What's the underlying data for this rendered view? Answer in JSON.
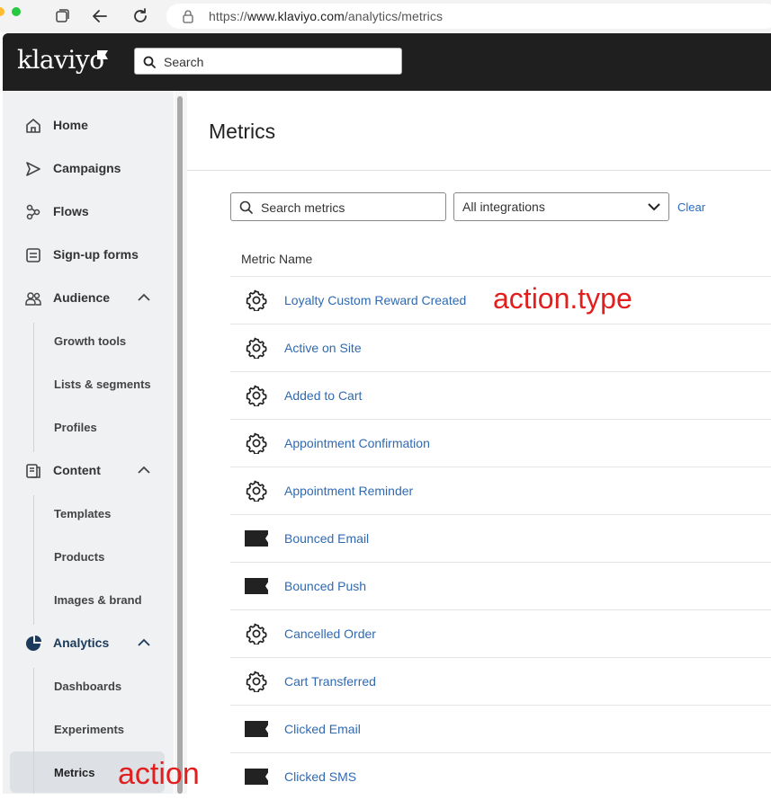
{
  "browser": {
    "url_prefix": "https://",
    "url_domain": "www.klaviyo.com",
    "url_path": "/analytics/metrics"
  },
  "header": {
    "logo": "klaviyo",
    "search_placeholder": "Search"
  },
  "sidebar": {
    "items": [
      {
        "label": "Home",
        "icon": "home-icon"
      },
      {
        "label": "Campaigns",
        "icon": "send-icon"
      },
      {
        "label": "Flows",
        "icon": "flows-icon"
      },
      {
        "label": "Sign-up forms",
        "icon": "form-icon"
      },
      {
        "label": "Audience",
        "icon": "people-icon",
        "expanded": true
      },
      {
        "label": "Content",
        "icon": "content-icon",
        "expanded": true
      },
      {
        "label": "Analytics",
        "icon": "pie-chart-icon",
        "expanded": true
      }
    ],
    "audience_sub": [
      "Growth tools",
      "Lists & segments",
      "Profiles"
    ],
    "content_sub": [
      "Templates",
      "Products",
      "Images & brand"
    ],
    "analytics_sub": [
      "Dashboards",
      "Experiments",
      "Metrics"
    ],
    "active_item": "Metrics"
  },
  "annotations": {
    "sidebar_label": "action",
    "row_label": "action.type"
  },
  "main": {
    "title": "Metrics",
    "search_placeholder": "Search metrics",
    "filter_value": "All integrations",
    "clear_label": "Clear",
    "column_header": "Metric Name",
    "rows": [
      {
        "name": "Loyalty Custom Reward Created",
        "icon": "gear-icon"
      },
      {
        "name": "Active on Site",
        "icon": "gear-icon"
      },
      {
        "name": "Added to Cart",
        "icon": "gear-icon"
      },
      {
        "name": "Appointment Confirmation",
        "icon": "gear-icon"
      },
      {
        "name": "Appointment Reminder",
        "icon": "gear-icon"
      },
      {
        "name": "Bounced Email",
        "icon": "klaviyo-flag-icon"
      },
      {
        "name": "Bounced Push",
        "icon": "klaviyo-flag-icon"
      },
      {
        "name": "Cancelled Order",
        "icon": "gear-icon"
      },
      {
        "name": "Cart Transferred",
        "icon": "gear-icon"
      },
      {
        "name": "Clicked Email",
        "icon": "klaviyo-flag-icon"
      },
      {
        "name": "Clicked SMS",
        "icon": "klaviyo-flag-icon"
      }
    ]
  }
}
